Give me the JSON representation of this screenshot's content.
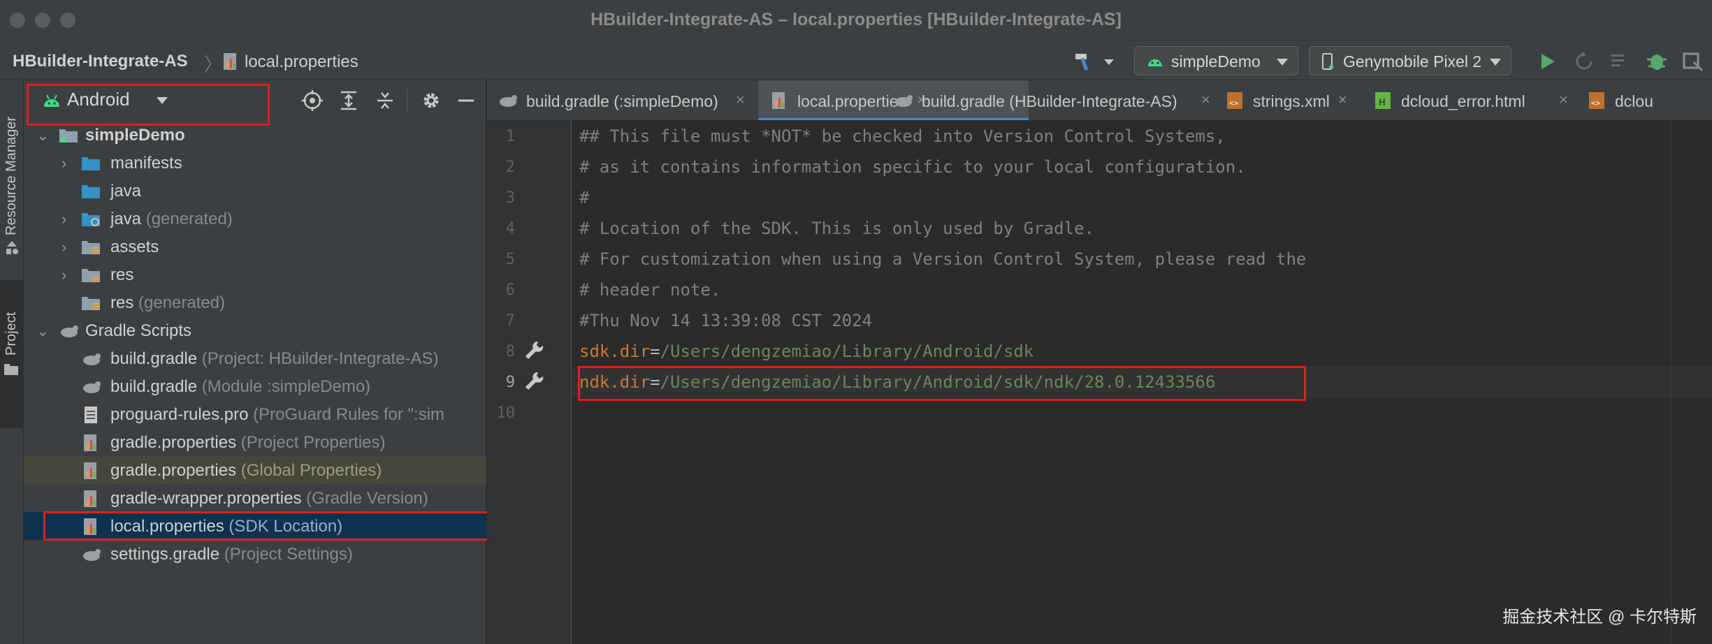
{
  "window": {
    "title": "HBuilder-Integrate-AS – local.properties [HBuilder-Integrate-AS]"
  },
  "navbar": {
    "project": "HBuilder-Integrate-AS",
    "file": "local.properties",
    "run_config": "simpleDemo",
    "device": "Genymobile Pixel 2"
  },
  "toolstrip": {
    "resource_manager": "Resource Manager",
    "project": "Project"
  },
  "project_panel": {
    "view": "Android",
    "tree": [
      {
        "name": "simpleDemo",
        "hint": ""
      },
      {
        "name": "manifests",
        "hint": ""
      },
      {
        "name": "java",
        "hint": ""
      },
      {
        "name": "java",
        "hint": "(generated)"
      },
      {
        "name": "assets",
        "hint": ""
      },
      {
        "name": "res",
        "hint": ""
      },
      {
        "name": "res",
        "hint": "(generated)"
      },
      {
        "name": "Gradle Scripts",
        "hint": ""
      },
      {
        "name": "build.gradle",
        "hint": "(Project: HBuilder-Integrate-AS)"
      },
      {
        "name": "build.gradle",
        "hint": "(Module :simpleDemo)"
      },
      {
        "name": "proguard-rules.pro",
        "hint": "(ProGuard Rules for \":sim"
      },
      {
        "name": "gradle.properties",
        "hint": "(Project Properties)"
      },
      {
        "name": "gradle.properties",
        "hint": "(Global Properties)"
      },
      {
        "name": "gradle-wrapper.properties",
        "hint": "(Gradle Version)"
      },
      {
        "name": "local.properties",
        "hint": "(SDK Location)"
      },
      {
        "name": "settings.gradle",
        "hint": "(Project Settings)"
      }
    ]
  },
  "tabs": [
    {
      "label": "build.gradle (:simpleDemo)"
    },
    {
      "label": "local.properties"
    },
    {
      "label": "build.gradle (HBuilder-Integrate-AS)"
    },
    {
      "label": "strings.xml"
    },
    {
      "label": "dcloud_error.html"
    },
    {
      "label": "dclou"
    }
  ],
  "editor": {
    "line_numbers": [
      "1",
      "2",
      "3",
      "4",
      "5",
      "6",
      "7",
      "8",
      "9",
      "10"
    ],
    "lines": [
      "## This file must *NOT* be checked into Version Control Systems,",
      "# as it contains information specific to your local configuration.",
      "#",
      "# Location of the SDK. This is only used by Gradle.",
      "# For customization when using a Version Control System, please read the",
      "# header note.",
      "#Thu Nov 14 13:39:08 CST 2024"
    ],
    "sdk_key": "sdk.dir",
    "sdk_value": "/Users/dengzemiao/Library/Android/sdk",
    "ndk_key": "ndk.dir",
    "ndk_value": "/Users/dengzemiao/Library/Android/sdk/ndk/28.0.12433566",
    "eq": "="
  },
  "watermark": "掘金技术社区 @ 卡尔特斯",
  "colors": {
    "highlight_box": "#e0201a",
    "selection": "#0d3350",
    "accent": "#4a88c7"
  }
}
